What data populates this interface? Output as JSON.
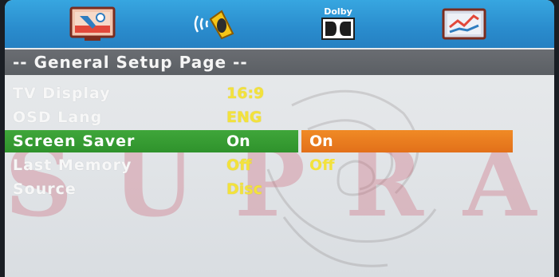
{
  "tabs": [
    {
      "name": "general-setup",
      "icon": "general-setup-icon",
      "label": ""
    },
    {
      "name": "audio-setup",
      "icon": "speaker-icon",
      "label": ""
    },
    {
      "name": "dolby-setup",
      "icon": "dolby-icon",
      "label": "Dolby"
    },
    {
      "name": "preference",
      "icon": "preference-icon",
      "label": ""
    }
  ],
  "header": {
    "title": "-- General Setup Page --"
  },
  "watermark": "SUPRA",
  "menu": {
    "items": [
      {
        "label": "TV Display",
        "value": "16:9"
      },
      {
        "label": "OSD Lang",
        "value": "ENG"
      },
      {
        "label": "Screen Saver",
        "value": "On",
        "selected": true
      },
      {
        "label": "Last Memory",
        "value": "Off"
      },
      {
        "label": "Source",
        "value": "Disc"
      }
    ],
    "options": [
      "On",
      "Off"
    ]
  },
  "colors": {
    "icon_bar": "#2a8ccd",
    "header": "#5b5f64",
    "selected_row": "#3fa63a",
    "selected_option": "#f08a25",
    "value_text": "#f3e23b"
  }
}
